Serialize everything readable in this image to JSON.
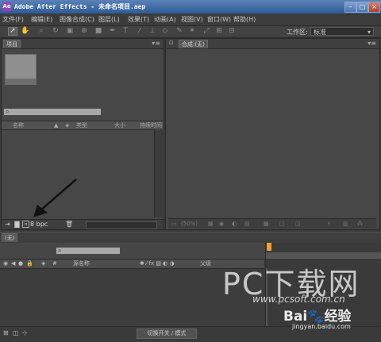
{
  "window": {
    "app_icon": "Ae",
    "title": "Adobe After Effects - 未命名项目.aep"
  },
  "menu": [
    "文件(F)",
    "编辑(E)",
    "图像合成(C)",
    "图层(L)",
    "效果(T)",
    "动画(A)",
    "视图(V)",
    "窗口(W)",
    "帮助(H)"
  ],
  "toolbar": {
    "workspace_label": "工作区:",
    "workspace_value": "标准"
  },
  "project_panel": {
    "tab": "项目",
    "columns": {
      "name": "名称",
      "type": "类型",
      "size": "大小",
      "frame_rate": "持续时间"
    },
    "bpc": "8 bpc"
  },
  "comp_panel": {
    "tab": "合成:(无)",
    "zoom": "(50%)"
  },
  "timeline": {
    "tab": "(无)",
    "columns": {
      "source_name": "源名称",
      "parent": "父级"
    },
    "switch_button": "切换开关 / 模式"
  },
  "watermark": {
    "pc": "PC下载网",
    "url": "www.pcsoft.com.cn",
    "baidu": "Bai",
    "baidu_cn": "经验",
    "jingyan": "jingyan.baidu.com"
  },
  "colors": {
    "accent": "#f0a030",
    "title_bar": "#2f5a96"
  }
}
